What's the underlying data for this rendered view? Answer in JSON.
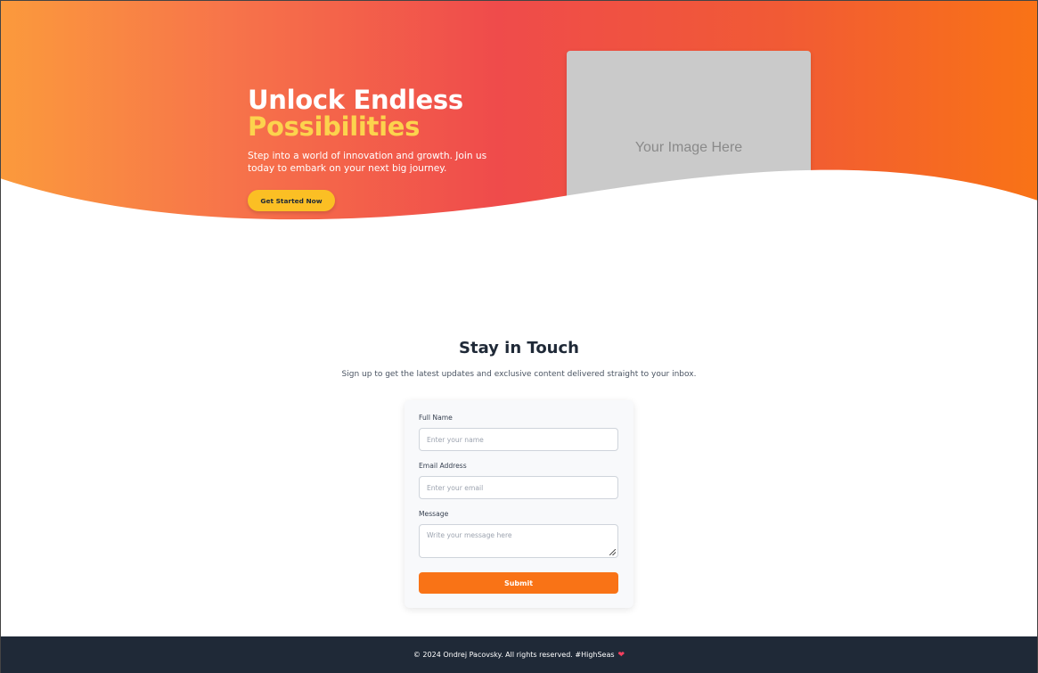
{
  "hero": {
    "title_line1": "Unlock Endless",
    "title_line2": "Possibilities",
    "subtitle": "Step into a world of innovation and growth. Join us today to embark on your next big journey.",
    "cta_label": "Get Started Now",
    "image_placeholder": "Your Image Here"
  },
  "contact": {
    "title": "Stay in Touch",
    "subtitle": "Sign up to get the latest updates and exclusive content delivered straight to your inbox.",
    "fields": [
      {
        "label": "Full Name",
        "placeholder": "Enter your name"
      },
      {
        "label": "Email Address",
        "placeholder": "Enter your email"
      },
      {
        "label": "Message",
        "placeholder": "Write your message here"
      }
    ],
    "submit_label": "Submit"
  },
  "footer": {
    "text": "© 2024 Ondrej Pacovsky. All rights reserved. #HighSeas",
    "icon": "heart-icon"
  },
  "colors": {
    "accent": "#f97316",
    "highlight": "#fcd34d",
    "cta": "#fbbf24",
    "footer_bg": "#1f2937"
  }
}
